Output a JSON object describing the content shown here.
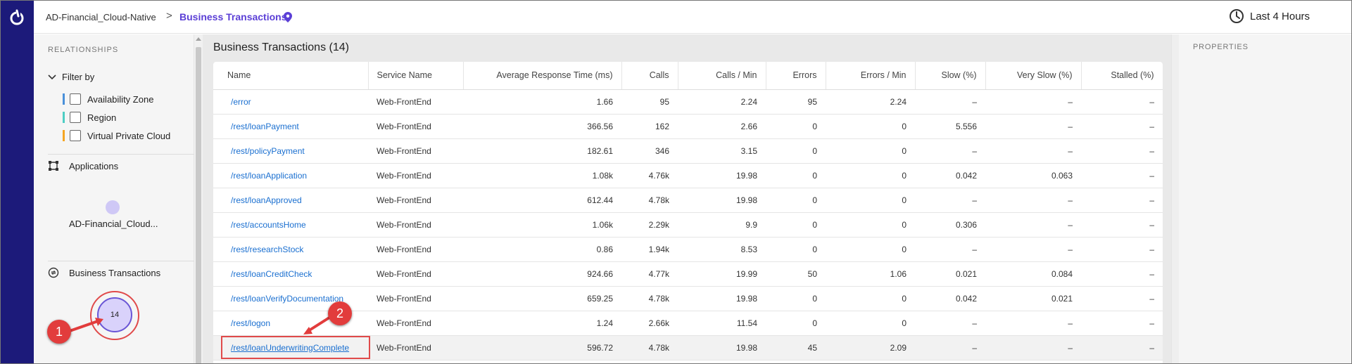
{
  "header": {
    "app_name": "AD-Financial_Cloud-Native",
    "separator": ">",
    "current_page": "Business Transactions",
    "time_range": "Last 4 Hours"
  },
  "left_panel": {
    "title": "RELATIONSHIPS",
    "filter_by": "Filter by",
    "filters": [
      {
        "label": "Availability Zone",
        "color": "#4a90d9"
      },
      {
        "label": "Region",
        "color": "#4ecdc4"
      },
      {
        "label": "Virtual Private Cloud",
        "color": "#f5a623"
      }
    ],
    "applications_label": "Applications",
    "application_name": "AD-Financial_Cloud...",
    "business_transactions_label": "Business Transactions",
    "bt_count": "14"
  },
  "main": {
    "title": "Business Transactions (14)",
    "columns": [
      "Name",
      "Service Name",
      "Average Response Time (ms)",
      "Calls",
      "Calls / Min",
      "Errors",
      "Errors / Min",
      "Slow (%)",
      "Very Slow (%)",
      "Stalled (%)"
    ],
    "rows": [
      [
        "/error",
        "Web-FrontEnd",
        "1.66",
        "95",
        "2.24",
        "95",
        "2.24",
        "–",
        "–",
        "–"
      ],
      [
        "/rest/loanPayment",
        "Web-FrontEnd",
        "366.56",
        "162",
        "2.66",
        "0",
        "0",
        "5.556",
        "–",
        "–"
      ],
      [
        "/rest/policyPayment",
        "Web-FrontEnd",
        "182.61",
        "346",
        "3.15",
        "0",
        "0",
        "–",
        "–",
        "–"
      ],
      [
        "/rest/loanApplication",
        "Web-FrontEnd",
        "1.08k",
        "4.76k",
        "19.98",
        "0",
        "0",
        "0.042",
        "0.063",
        "–"
      ],
      [
        "/rest/loanApproved",
        "Web-FrontEnd",
        "612.44",
        "4.78k",
        "19.98",
        "0",
        "0",
        "–",
        "–",
        "–"
      ],
      [
        "/rest/accountsHome",
        "Web-FrontEnd",
        "1.06k",
        "2.29k",
        "9.9",
        "0",
        "0",
        "0.306",
        "–",
        "–"
      ],
      [
        "/rest/researchStock",
        "Web-FrontEnd",
        "0.86",
        "1.94k",
        "8.53",
        "0",
        "0",
        "–",
        "–",
        "–"
      ],
      [
        "/rest/loanCreditCheck",
        "Web-FrontEnd",
        "924.66",
        "4.77k",
        "19.99",
        "50",
        "1.06",
        "0.021",
        "0.084",
        "–"
      ],
      [
        "/rest/loanVerifyDocumentation",
        "Web-FrontEnd",
        "659.25",
        "4.78k",
        "19.98",
        "0",
        "0",
        "0.042",
        "0.021",
        "–"
      ],
      [
        "/rest/logon",
        "Web-FrontEnd",
        "1.24",
        "2.66k",
        "11.54",
        "0",
        "0",
        "–",
        "–",
        "–"
      ],
      [
        "/rest/loanUnderwritingComplete",
        "Web-FrontEnd",
        "596.72",
        "4.78k",
        "19.98",
        "45",
        "2.09",
        "–",
        "–",
        "–"
      ]
    ]
  },
  "right_panel": {
    "title": "PROPERTIES"
  },
  "callouts": [
    "1",
    "2"
  ],
  "colors": {
    "rail": "#1c1a7a",
    "accent": "#5b3fd6",
    "link": "#1a6fd0",
    "callout": "#e23c3c"
  },
  "icons": [
    "logo-icon",
    "chevron-right-icon",
    "location-pin-icon",
    "clock-icon",
    "close-icon",
    "chevron-down-icon",
    "applications-icon",
    "business-transactions-icon"
  ]
}
